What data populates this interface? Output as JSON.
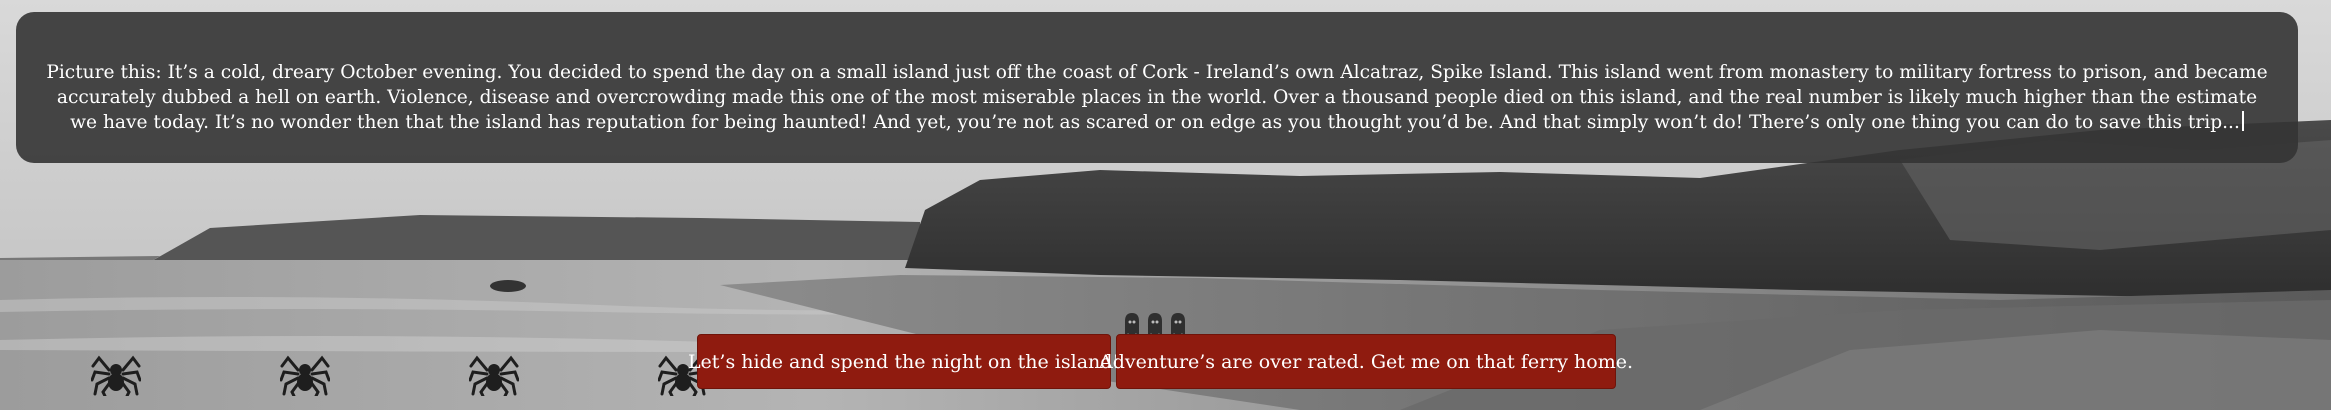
{
  "story": {
    "text": "Picture this: It’s a cold, dreary October evening. You decided to spend the day on a small island just off the coast of Cork - Ireland’s own Alcatraz, Spike Island. This island went from monastery to military fortress to prison, and became accurately dubbed a hell on earth. Violence, disease and overcrowding made this one of the most miserable places in the world. Over a thousand people died on this island, and the real number is likely much higher than the estimate we have today. It’s no wonder then that the island has reputation for being haunted! And yet, you’re not as scared or on edge as you thought you’d be. And that simply won’t do! There’s only one thing you can do to save this trip..."
  },
  "choices": [
    {
      "label": "Let’s hide and spend the night on the island!"
    },
    {
      "label": "Adventure’s are over rated. Get me on that ferry home."
    }
  ],
  "decorations": {
    "spider_icon": "spider-icon",
    "ghost_icon": "ghost-icon"
  },
  "colors": {
    "panel": "#343434",
    "button": "#8f1b0f",
    "text": "#ffffff"
  }
}
